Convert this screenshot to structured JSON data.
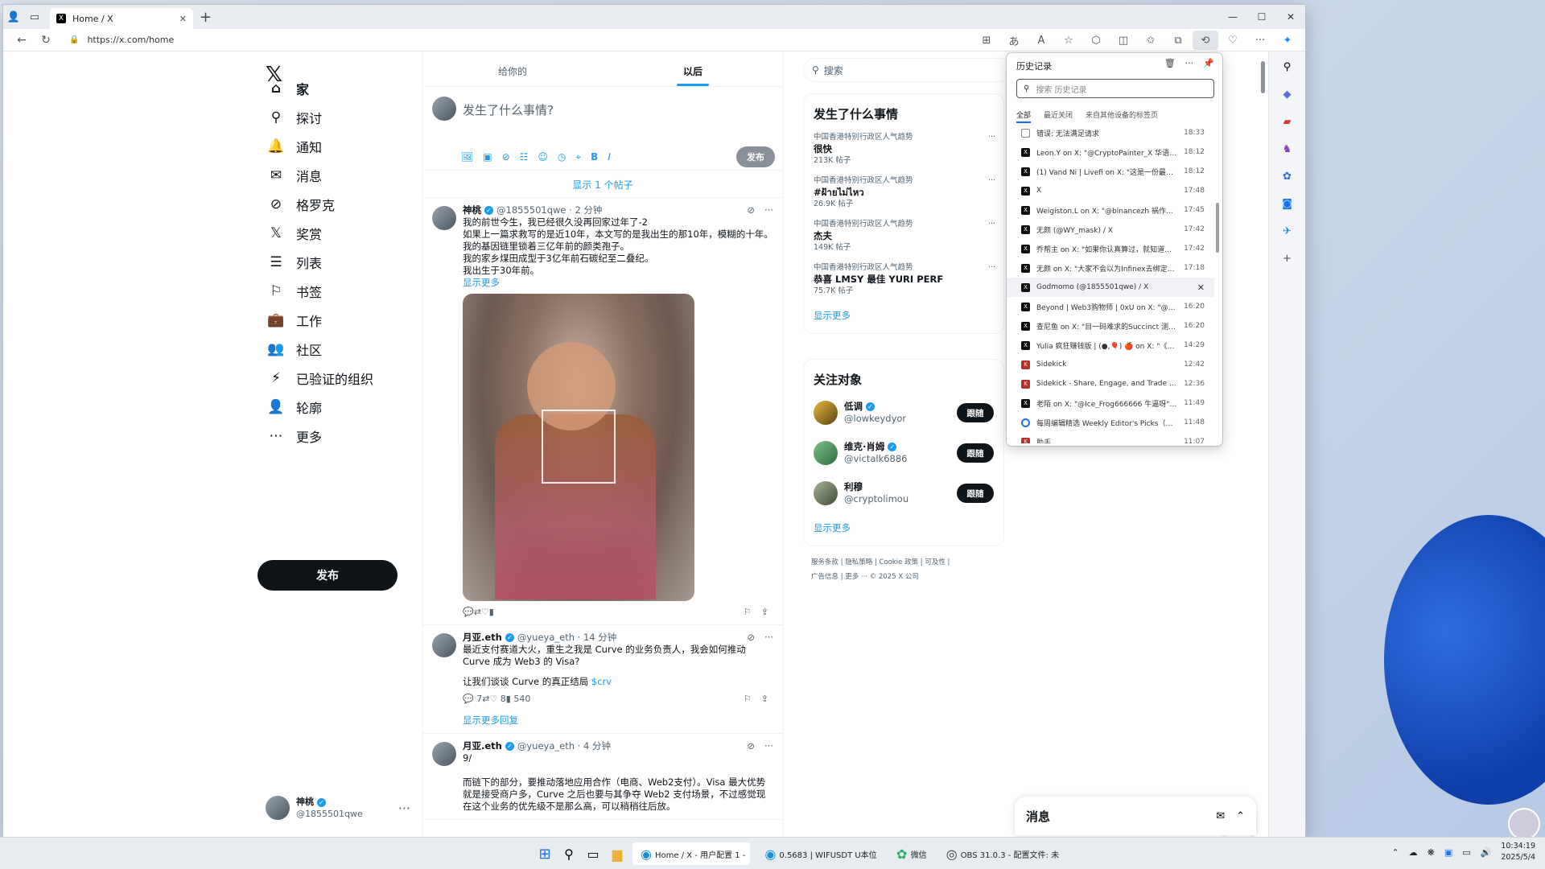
{
  "browser": {
    "tab_title": "Home / X",
    "url": "https://x.com/home"
  },
  "xnav": {
    "logo": "𝕏",
    "items": [
      {
        "label": "家"
      },
      {
        "label": "探讨"
      },
      {
        "label": "通知"
      },
      {
        "label": "消息"
      },
      {
        "label": "格罗克"
      },
      {
        "label": "奖赏"
      },
      {
        "label": "列表"
      },
      {
        "label": "书签"
      },
      {
        "label": "工作"
      },
      {
        "label": "社区"
      },
      {
        "label": "已验证的组织"
      },
      {
        "label": "轮廓"
      },
      {
        "label": "更多"
      }
    ],
    "post_button": "发布",
    "profile": {
      "name": "神桃",
      "handle": "@1855501qwe",
      "more": "···"
    }
  },
  "timeline": {
    "tabs": [
      {
        "label": "给你的"
      },
      {
        "label": "以后"
      }
    ],
    "composer": {
      "placeholder": "发生了什么事情?",
      "post": "发布"
    },
    "show_new": "显示 1 个帖子",
    "tweets": [
      {
        "name": "神桃",
        "meta": "@1855501qwe · 2 分钟",
        "text": "我的前世今生，我已经很久没再回家过年了-2\n如果上一篇求救写的是近10年，本文写的是我出生的那10年，模糊的十年。\n我的基因链里锁着三亿年前的颜类孢子。\n我的家乡煤田成型于3亿年前石碳纪至二叠纪。\n我出生于30年前。",
        "show_more": "显示更多"
      },
      {
        "name": "月亚.eth",
        "meta": "@yueya_eth · 14 分钟",
        "text": "最近支付赛道大火，重生之我是 Curve 的业务负责人，我会如何推动 Curve 成为 Web3 的 Visa?",
        "text2": "让我们谈谈 Curve 的真正结局",
        "cashtag": "$crv",
        "replies": "7",
        "likes": "8",
        "views": "540",
        "show_replies": "显示更多回复"
      },
      {
        "name": "月亚.eth",
        "meta": "@yueya_eth · 4 分钟",
        "text": "9/\n\n而链下的部分，要推动落地应用合作（电商、Web2支付）。Visa 最大优势就是接受商户多，Curve 之后也要与其争夺 Web2 支付场景，不过感觉现在这个业务的优先级不是那么高，可以稍稍往后放。"
      }
    ]
  },
  "right": {
    "search_placeholder": "搜索",
    "trends_title": "发生了什么事情",
    "trends": [
      {
        "context": "中国香港特别行政区人气趋势",
        "topic": "很快",
        "count": "213K 帖子"
      },
      {
        "context": "中国香港特别行政区人气趋势",
        "topic": "#ฝ้ายไม่ไหว",
        "count": "26.9K 帖子"
      },
      {
        "context": "中国香港特别行政区人气趋势",
        "topic": "杰夫",
        "count": "149K 帖子"
      },
      {
        "context": "中国香港特别行政区人气趋势",
        "topic": "恭喜 LMSY 最佳 YURI PERF",
        "count": "75.7K 帖子"
      }
    ],
    "show_more": "显示更多",
    "follow_title": "关注对象",
    "follows": [
      {
        "name": "低调",
        "handle": "@lowkeydyor",
        "btn": "跟随"
      },
      {
        "name": "维克·肖姆",
        "handle": "@victalk6886",
        "btn": "跟随"
      },
      {
        "name": "利穆",
        "handle": "@cryptolimou",
        "btn": "跟随"
      }
    ],
    "footer_line1": "服务条款 | 隐私策略 | Cookie 政策 | 可及性 |",
    "footer_line2": "广告信息 | 更多 ··· © 2025 X 公司"
  },
  "history": {
    "title": "历史记录",
    "search_placeholder": "搜索 历史记录",
    "tabs": [
      {
        "label": "全部"
      },
      {
        "label": "最近关闭"
      },
      {
        "label": "来自其他设备的标签页"
      }
    ],
    "items": [
      {
        "label": "错误: 无法满足请求",
        "time": "18:33",
        "icon": "doc"
      },
      {
        "label": "Leon.Y on X: \"@CryptoPainter_X 华语区...",
        "time": "18:12",
        "icon": "x"
      },
      {
        "label": "(1) Vand Ni | Livefi on X: \"这是一份最新...",
        "time": "18:12",
        "icon": "x"
      },
      {
        "label": "X",
        "time": "17:48",
        "icon": "x"
      },
      {
        "label": "Weigiston.L on X: \"@binancezh 祸作...",
        "time": "17:45",
        "icon": "x"
      },
      {
        "label": "无颜 (@WY_mask) / X",
        "time": "17:42",
        "icon": "x"
      },
      {
        "label": "乔帮主 on X: \"如果你认真算过，就知道币...",
        "time": "17:42",
        "icon": "x"
      },
      {
        "label": "无颜 on X: \"大家不会以为Infinex去绑定个...",
        "time": "17:18",
        "icon": "x"
      },
      {
        "label": "Godmomo (@1855501qwe) / X",
        "time": "",
        "icon": "x",
        "hover": true
      },
      {
        "label": "Beyond | Web3购物师 | 0xU on X: \"@xia...",
        "time": "16:20",
        "icon": "x"
      },
      {
        "label": "查尼鱼 on X: \"目一码难求的Succinct 测试...",
        "time": "16:20",
        "icon": "x"
      },
      {
        "label": "Yulia 疯狂赚钱版 | (●,🎈) 🍎 on X: \"《一...",
        "time": "14:29",
        "icon": "x"
      },
      {
        "label": "Sidekick",
        "time": "12:42",
        "icon": "sk"
      },
      {
        "label": "Sidekick - Share, Engage, and Trade Live...",
        "time": "12:36",
        "icon": "sk"
      },
      {
        "label": "老陌 on X: \"@Ice_Frog666666 牛逼呀\" ...",
        "time": "11:49",
        "icon": "x"
      },
      {
        "label": "每周编辑精选 Weekly Editor's Picks（042...",
        "time": "11:48",
        "icon": "blue"
      },
      {
        "label": "助手",
        "time": "11:07",
        "icon": "sk"
      }
    ]
  },
  "dm": {
    "title": "消息"
  },
  "taskbar": {
    "apps": [
      {
        "label": "Home / X - 用户配置 1 -"
      },
      {
        "label": "0.5683 | WIFUSDT U本位"
      },
      {
        "label": "微信"
      },
      {
        "label": "OBS 31.0.3 - 配置文件: 未"
      }
    ],
    "time": "10:34:19",
    "date": "2025/5/4"
  }
}
